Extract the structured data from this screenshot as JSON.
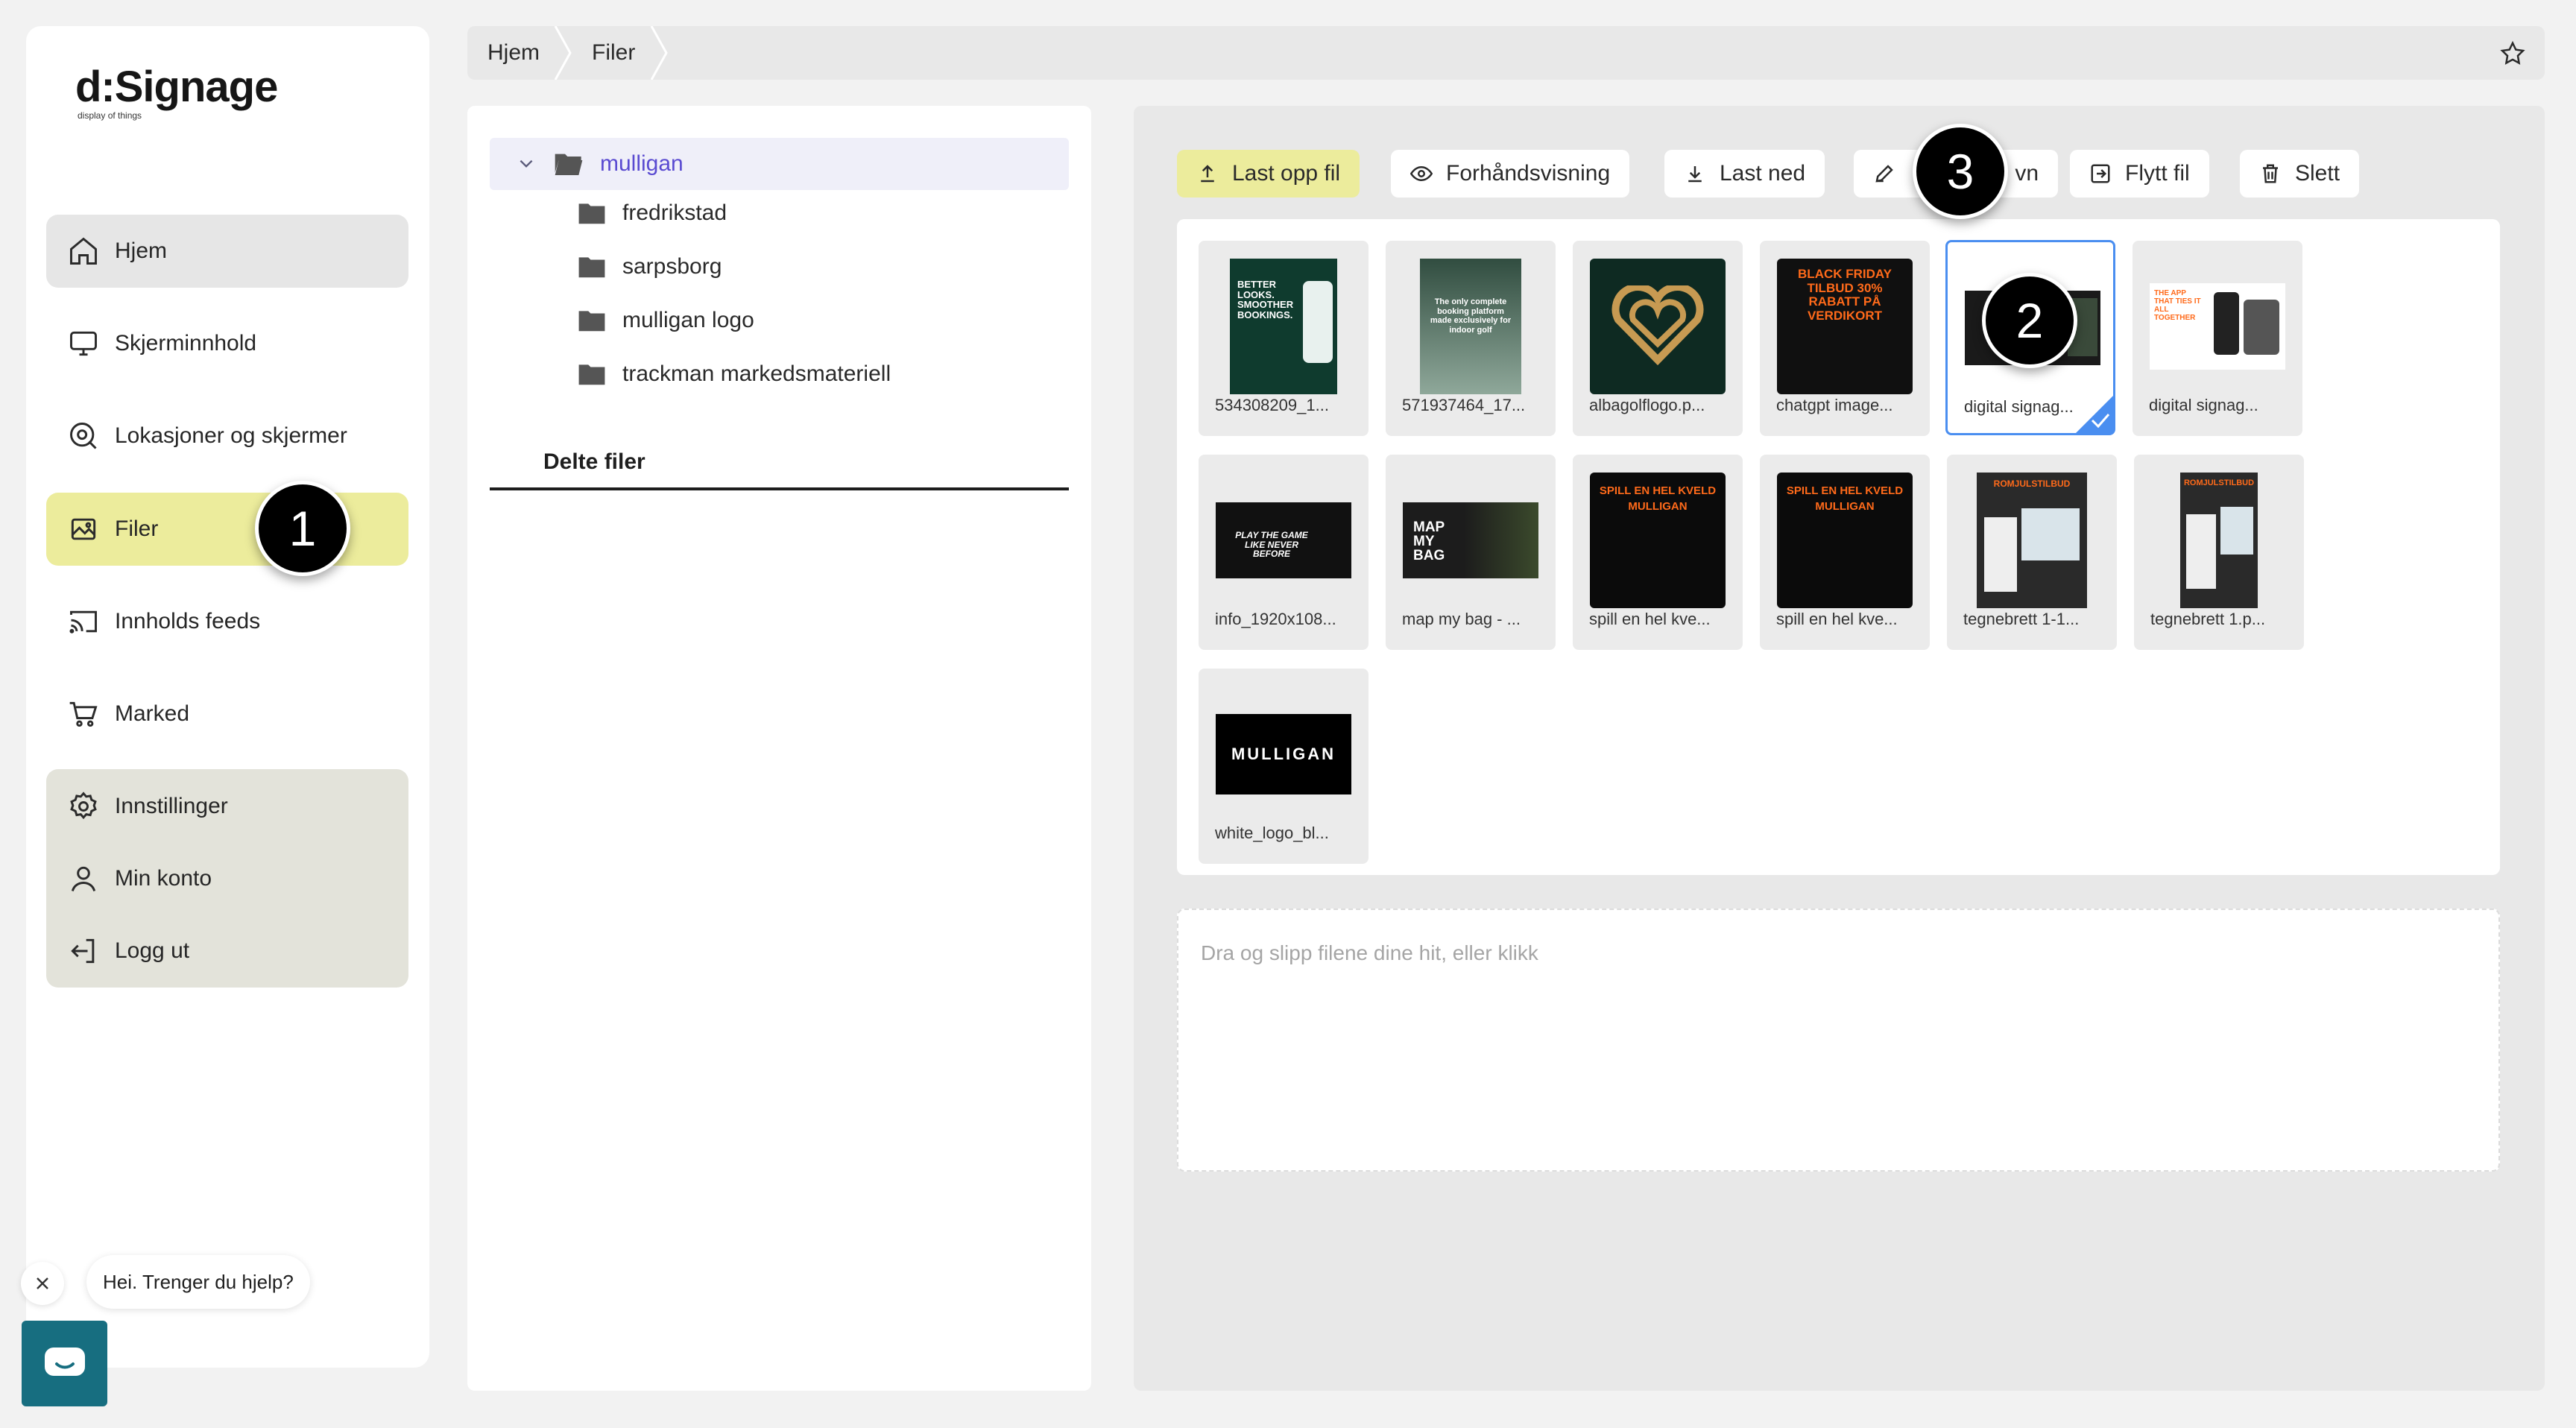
{
  "app": {
    "logo_main": "d:Signage",
    "logo_sub": "display of things"
  },
  "sidebar": {
    "items": [
      {
        "label": "Hjem",
        "icon": "home-icon"
      },
      {
        "label": "Skjerminnhold",
        "icon": "monitor-icon"
      },
      {
        "label": "Lokasjoner og skjermer",
        "icon": "location-icon"
      },
      {
        "label": "Filer",
        "icon": "image-icon"
      },
      {
        "label": "Innholds feeds",
        "icon": "cast-icon"
      },
      {
        "label": "Marked",
        "icon": "cart-icon"
      }
    ],
    "group": [
      {
        "label": "Innstillinger",
        "icon": "gear-icon"
      },
      {
        "label": "Min konto",
        "icon": "user-icon"
      },
      {
        "label": "Logg ut",
        "icon": "logout-icon"
      }
    ]
  },
  "breadcrumb": [
    "Hjem",
    "Filer"
  ],
  "folders": {
    "root": "mulligan",
    "children": [
      "fredrikstad",
      "sarpsborg",
      "mulligan logo",
      "trackman markedsmateriell"
    ],
    "shared_tab": "Delte filer"
  },
  "toolbar": {
    "upload": "Last opp fil",
    "preview": "Forhåndsvisning",
    "download": "Last ned",
    "rename_visible": "vn",
    "move": "Flytt fil",
    "delete": "Slett"
  },
  "files": [
    {
      "name": "534308209_1...",
      "thumb_text": "BETTER LOOKS. SMOOTHER BOOKINGS."
    },
    {
      "name": "571937464_17...",
      "thumb_text": "The only complete booking platform made exclusively for indoor golf"
    },
    {
      "name": "albagolflogo.p...",
      "thumb_text": ""
    },
    {
      "name": "chatgpt image...",
      "thumb_text": "BLACK FRIDAY TILBUD 30% RABATT PÅ VERDIKORT"
    },
    {
      "name": "digital signag...",
      "thumb_text": ""
    },
    {
      "name": "digital signag...",
      "thumb_text": "THE APP THAT TIES IT ALL TOGETHER"
    },
    {
      "name": "info_1920x108...",
      "thumb_text": "PLAY THE GAME LIKE NEVER BEFORE"
    },
    {
      "name": "map my bag - ...",
      "thumb_text": "MAP MY BAG"
    },
    {
      "name": "spill en hel kve...",
      "thumb_text": "SPILL EN HEL KVELD MULLIGAN"
    },
    {
      "name": "spill en hel kve...",
      "thumb_text": "SPILL EN HEL KVELD MULLIGAN"
    },
    {
      "name": "tegnebrett 1-1...",
      "thumb_text": "ROMJULSTILBUD"
    },
    {
      "name": "tegnebrett 1.p...",
      "thumb_text": "ROMJULSTILBUD"
    },
    {
      "name": "white_logo_bl...",
      "thumb_text": "MULLIGAN"
    }
  ],
  "dropzone": {
    "text": "Dra og slipp filene dine hit, eller klikk"
  },
  "steps": [
    "1",
    "2",
    "3"
  ],
  "chat": {
    "bubble": "Hei. Trenger du hjelp?"
  },
  "colors": {
    "accent_yellow": "#ecec9c",
    "selected_blue": "#4a8ef0",
    "folder_purple": "#5a4bd1",
    "chat_teal": "#176e80"
  }
}
